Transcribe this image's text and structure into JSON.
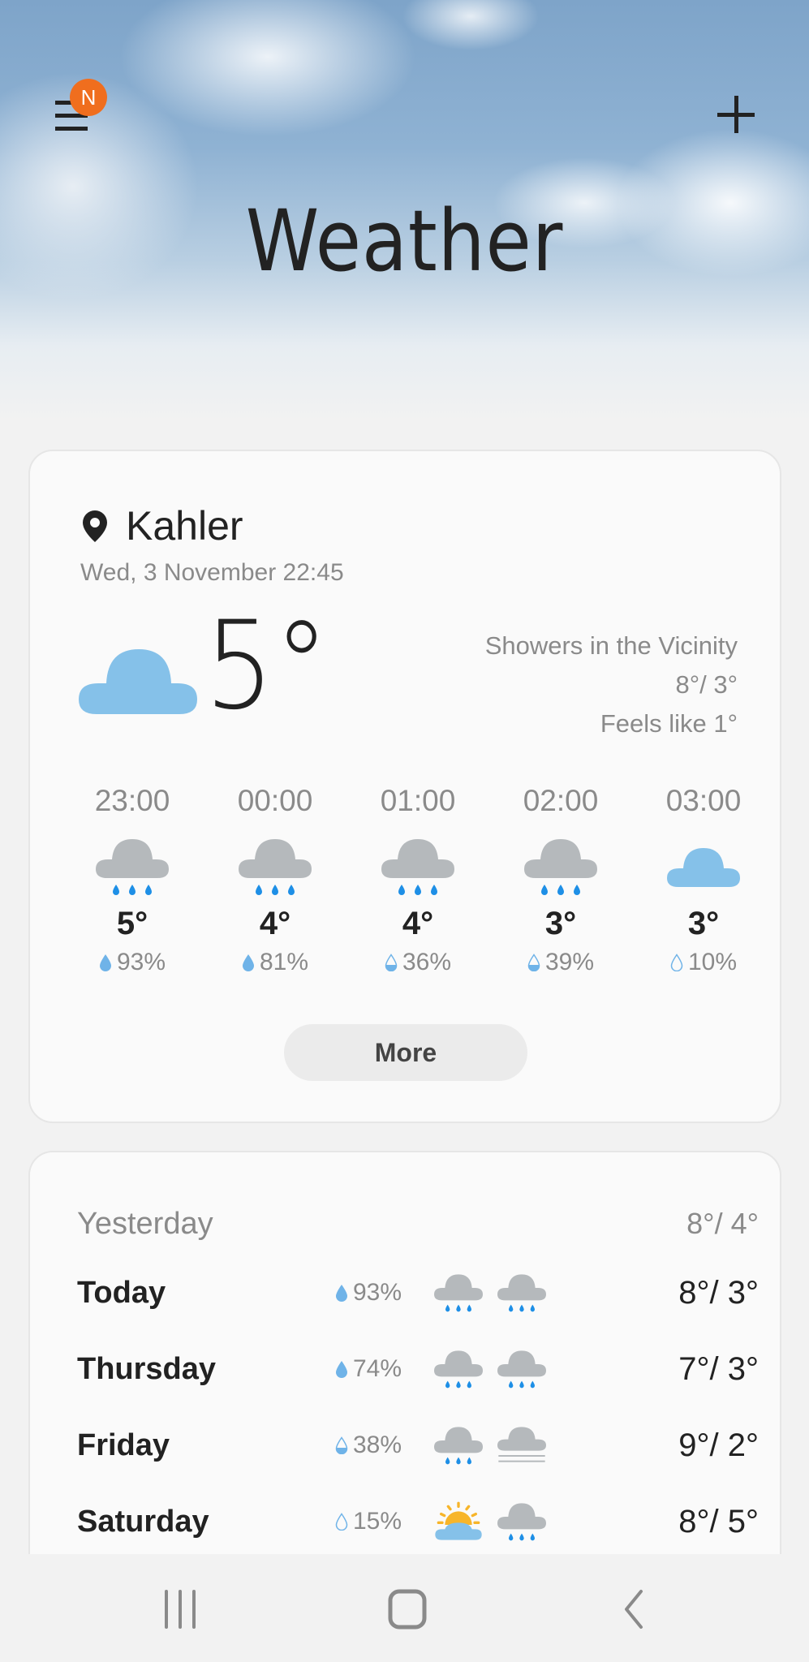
{
  "header": {
    "title": "Weather",
    "menu_icon": "hamburger-menu-icon",
    "notification_badge": "N",
    "add_icon": "plus-icon"
  },
  "current": {
    "location": "Kahler",
    "location_icon": "location-pin-icon",
    "datetime": "Wed, 3 November 22:45",
    "condition_icon": "cloudy-icon",
    "temperature": "5°",
    "condition": "Showers in the Vicinity",
    "high_low": "8°/ 3°",
    "feels_like": "Feels like 1°"
  },
  "hourly": [
    {
      "time": "23:00",
      "icon": "rain-icon",
      "temp": "5°",
      "precip": "93%",
      "drop": "full"
    },
    {
      "time": "00:00",
      "icon": "rain-icon",
      "temp": "4°",
      "precip": "81%",
      "drop": "full"
    },
    {
      "time": "01:00",
      "icon": "rain-icon",
      "temp": "4°",
      "precip": "36%",
      "drop": "half"
    },
    {
      "time": "02:00",
      "icon": "rain-icon",
      "temp": "3°",
      "precip": "39%",
      "drop": "half"
    },
    {
      "time": "03:00",
      "icon": "cloudy-icon",
      "temp": "3°",
      "precip": "10%",
      "drop": "empty"
    }
  ],
  "more_button": "More",
  "daily": [
    {
      "day": "Yesterday",
      "precip": "",
      "icons": [],
      "temps": "8°/ 4°"
    },
    {
      "day": "Today",
      "precip": "93%",
      "drop": "full",
      "icons": [
        "rain-icon",
        "rain-icon"
      ],
      "temps": "8°/ 3°"
    },
    {
      "day": "Thursday",
      "precip": "74%",
      "drop": "full",
      "icons": [
        "rain-icon",
        "rain-icon"
      ],
      "temps": "7°/ 3°"
    },
    {
      "day": "Friday",
      "precip": "38%",
      "drop": "half",
      "icons": [
        "rain-icon",
        "fog-icon"
      ],
      "temps": "9°/ 2°"
    },
    {
      "day": "Saturday",
      "precip": "15%",
      "drop": "empty",
      "icons": [
        "partly-sunny-icon",
        "rain-icon"
      ],
      "temps": "8°/ 5°"
    }
  ],
  "colors": {
    "badge": "#f06e1e",
    "cloud_blue": "#85c1e9",
    "cloud_grey": "#b5b9bc",
    "rain_drop": "#1e8fe6",
    "sun": "#f7b52a"
  },
  "navbar": {
    "recent_icon": "recent-apps-icon",
    "home_icon": "home-icon",
    "back_icon": "back-icon"
  }
}
